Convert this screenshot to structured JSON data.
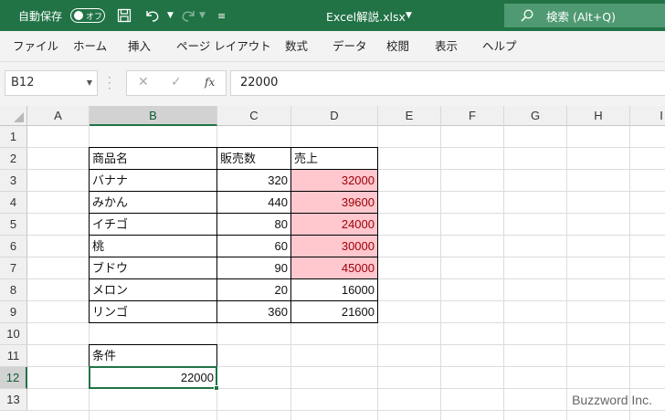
{
  "titlebar": {
    "autosave_label": "自動保存",
    "autosave_state": "オフ",
    "document_title": "Excel解説.xlsx",
    "search_placeholder": "検索 (Alt+Q)"
  },
  "ribbon": {
    "tabs": [
      "ファイル",
      "ホーム",
      "挿入",
      "ページ レイアウト",
      "数式",
      "データ",
      "校閲",
      "表示",
      "ヘルプ"
    ]
  },
  "formula_bar": {
    "name_box": "B12",
    "fx_label": "fx",
    "content": "22000"
  },
  "sheet": {
    "columns": [
      "A",
      "B",
      "C",
      "D",
      "E",
      "F",
      "G",
      "H",
      "I"
    ],
    "rows": [
      "1",
      "2",
      "3",
      "4",
      "5",
      "6",
      "7",
      "8",
      "9",
      "10",
      "11",
      "12",
      "13"
    ],
    "selected_cell": "B12",
    "table": {
      "headers": [
        "商品名",
        "販売数",
        "売上"
      ],
      "rows": [
        [
          "バナナ",
          "320",
          "32000"
        ],
        [
          "みかん",
          "440",
          "39600"
        ],
        [
          "イチゴ",
          "80",
          "24000"
        ],
        [
          "桃",
          "60",
          "30000"
        ],
        [
          "ブドウ",
          "90",
          "45000"
        ],
        [
          "メロン",
          "20",
          "16000"
        ],
        [
          "リンゴ",
          "360",
          "21600"
        ]
      ],
      "highlighted_rows": [
        0,
        1,
        2,
        3,
        4
      ],
      "highlight_fill": "#ffc7ce",
      "highlight_text": "#9c0006"
    },
    "condition_label": "条件",
    "condition_value": "22000"
  },
  "accent_color": "#217346",
  "watermark": "Buzzword Inc."
}
